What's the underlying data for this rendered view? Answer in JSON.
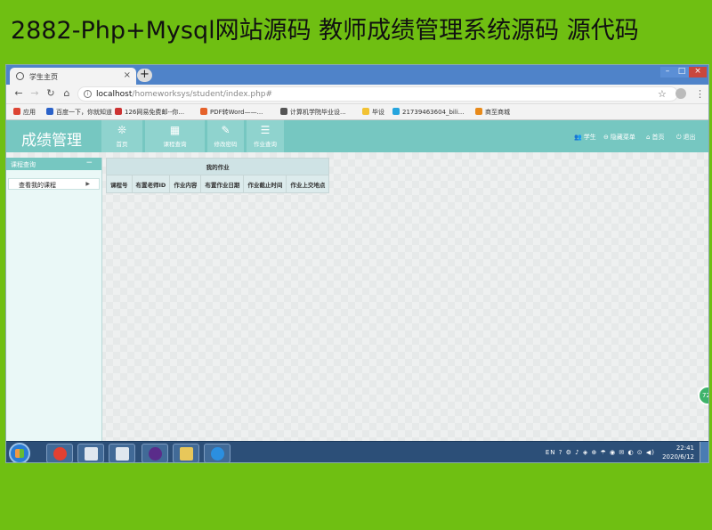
{
  "banner": {
    "title": "2882-Php+Mysql网站源码 教师成绩管理系统源码 源代码"
  },
  "browser": {
    "tab_title": "学生主页",
    "tab_close": "×",
    "new_tab": "+",
    "window_controls": {
      "min": "–",
      "max": "□",
      "close": "×"
    },
    "url_host": "localhost",
    "url_path": "/homeworksys/student/index.php#",
    "bookmarks": [
      {
        "label": "应用",
        "icon_color": "#d43"
      },
      {
        "label": "百度一下，你就知道",
        "icon_color": "#2b62c9"
      },
      {
        "label": "126网易免费邮--你...",
        "icon_color": "#c33"
      },
      {
        "label": "PDF转Word——...",
        "icon_color": "#e5622b"
      },
      {
        "label": "计算机学院毕业设...",
        "icon_color": "#555"
      },
      {
        "label": "毕设",
        "icon_color": "#f2c233"
      },
      {
        "label": "21739463604_bili...",
        "icon_color": "#26a5de"
      },
      {
        "label": "商至商城",
        "icon_color": "#e88a1a"
      }
    ]
  },
  "app": {
    "logo": "成绩管理",
    "nav": [
      {
        "label": "首页",
        "icon": "❊"
      },
      {
        "label": "课程查询",
        "icon": "▦"
      },
      {
        "label": "修改密码",
        "icon": "✎"
      },
      {
        "label": "作业查询",
        "icon": "☰"
      }
    ],
    "header_links": [
      {
        "label": "学生",
        "icon": "👥"
      },
      {
        "label": "隐藏菜单",
        "icon": "⊖"
      },
      {
        "label": "首页",
        "icon": "⌂"
      },
      {
        "label": "退出",
        "icon": "⏻"
      }
    ],
    "sidebar": {
      "header": "课程查询",
      "collapse": "−",
      "items": [
        {
          "label": "查看我的课程",
          "arrow": "▶"
        }
      ]
    },
    "table": {
      "caption": "我的作业",
      "columns": [
        "课程号",
        "布置老师ID",
        "作业内容",
        "布置作业日期",
        "作业截止时间",
        "作业上交地点"
      ],
      "rows": []
    },
    "float_button": "72"
  },
  "taskbar": {
    "tray_text": "EN ? ⚙ ♪ ◈ ⊕ ☂ ◉ ✉ ◐ ⊙ ◀)",
    "time": "22:41",
    "date": "2020/6/12",
    "apps": [
      {
        "name": "chrome",
        "color": "#e24032"
      },
      {
        "name": "window-a",
        "color": "#dfe7ef"
      },
      {
        "name": "window-b",
        "color": "#dfe7ef"
      },
      {
        "name": "media",
        "color": "#5a2c8a"
      },
      {
        "name": "explorer",
        "color": "#e8c75a"
      },
      {
        "name": "ie",
        "color": "#2b8fe0"
      }
    ]
  }
}
